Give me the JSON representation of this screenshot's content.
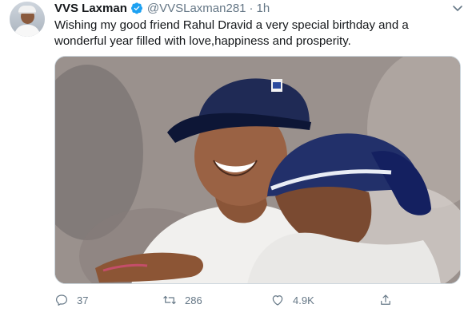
{
  "tweet": {
    "author_name": "VVS Laxman",
    "handle": "@VVSLaxman281",
    "separator": "·",
    "time": "1h",
    "text": "Wishing my good friend Rahul Dravid  a very special birthday and a wonderful year filled with love,happiness and prosperity.",
    "verified_icon": "verified-badge-icon",
    "more_icon": "chevron-down-icon"
  },
  "actions": {
    "reply_count": "37",
    "retweet_count": "286",
    "like_count": "4.9K",
    "reply_icon": "reply-icon",
    "retweet_icon": "retweet-icon",
    "like_icon": "heart-icon",
    "share_icon": "share-icon"
  },
  "colors": {
    "text": "#14171a",
    "muted": "#657786",
    "verified": "#1da1f2",
    "cap_navy": "#1f2a55"
  }
}
